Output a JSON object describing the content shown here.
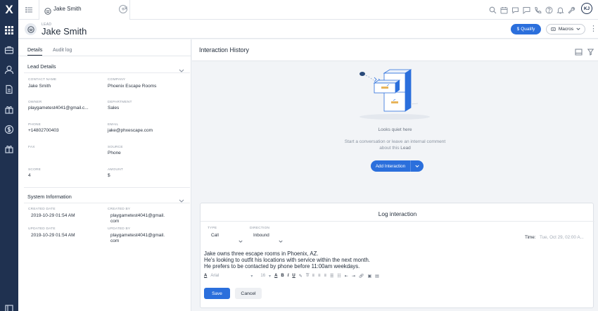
{
  "app": {
    "logo": "X"
  },
  "rail": {
    "icons": [
      "apps-grid-icon",
      "briefcase-icon",
      "person-icon",
      "document-icon",
      "gift-icon",
      "dollar-icon",
      "gift-icon",
      "collapse-icon"
    ]
  },
  "tabs": [
    {
      "label": "Jake Smith",
      "close": "×"
    }
  ],
  "topbar": {
    "add_tab": "+",
    "user_initials": "KJ"
  },
  "record": {
    "type": "LEAD",
    "name": "Jake Smith"
  },
  "actions": {
    "qualify_label": "Qualify",
    "qualify_symbol": "$",
    "macros_label": "Macros",
    "more": "⋮"
  },
  "left_tabs": {
    "details": "Details",
    "audit_log": "Audit log"
  },
  "lead_details": {
    "heading": "Lead Details",
    "contact_name_label": "CONTACT NAME",
    "contact_name": "Jake Smith",
    "company_label": "COMPANY",
    "company": "Phoenix Escape Rooms",
    "owner_label": "OWNER",
    "owner": "playgametest4041@gmail.c...",
    "department_label": "DEPARTMENT",
    "department": "Sales",
    "phone_label": "PHONE",
    "phone": "+14802700403",
    "email_label": "EMAIL",
    "email": "jake@phxescape.com",
    "fax_label": "FAX",
    "source_label": "SOURCE",
    "source": "Phone",
    "score_label": "SCORE",
    "score": "4",
    "amount_label": "AMOUNT",
    "amount": "$"
  },
  "system_info": {
    "heading": "System Information",
    "created_date_label": "CREATED DATE",
    "created_date": "2019-10-29 01:54 AM",
    "created_by_label": "CREATED BY",
    "created_by_1": "playgametest4041@gmail.",
    "created_by_2": "com",
    "updated_date_label": "UPDATED DATE",
    "updated_date": "2019-10-29 01:54 AM",
    "updated_by_label": "UPDATED BY",
    "updated_by_1": "playgametest4041@gmail.",
    "updated_by_2": "com"
  },
  "interaction": {
    "title": "Interaction History",
    "empty_title": "Looks quiet here",
    "hint_line1": "Start a conversation or leave an internal comment",
    "hint_line2_prefix": "about this",
    "hint_line2_bold": "Lead",
    "add_button": "Add Interaction"
  },
  "log": {
    "title": "Log interaction",
    "type_label": "TYPE",
    "type_value": "Call",
    "direction_label": "DIRECTION",
    "direction_value": "Inbound",
    "time_label": "Time:",
    "time_value": "Tue, Oct 29, 02:00 A...",
    "note_lines": [
      "Jake owns three escape rooms in Phoenix, AZ.",
      "He's looking to outfit his locations with service within the next month.",
      "He prefers to be contacted by phone before 11:00am weekdays."
    ],
    "font": "Arial",
    "font_size": "16",
    "save": "Save",
    "cancel": "Cancel"
  },
  "colors": {
    "rail": "#1f3150",
    "accent": "#2b6fdc"
  }
}
